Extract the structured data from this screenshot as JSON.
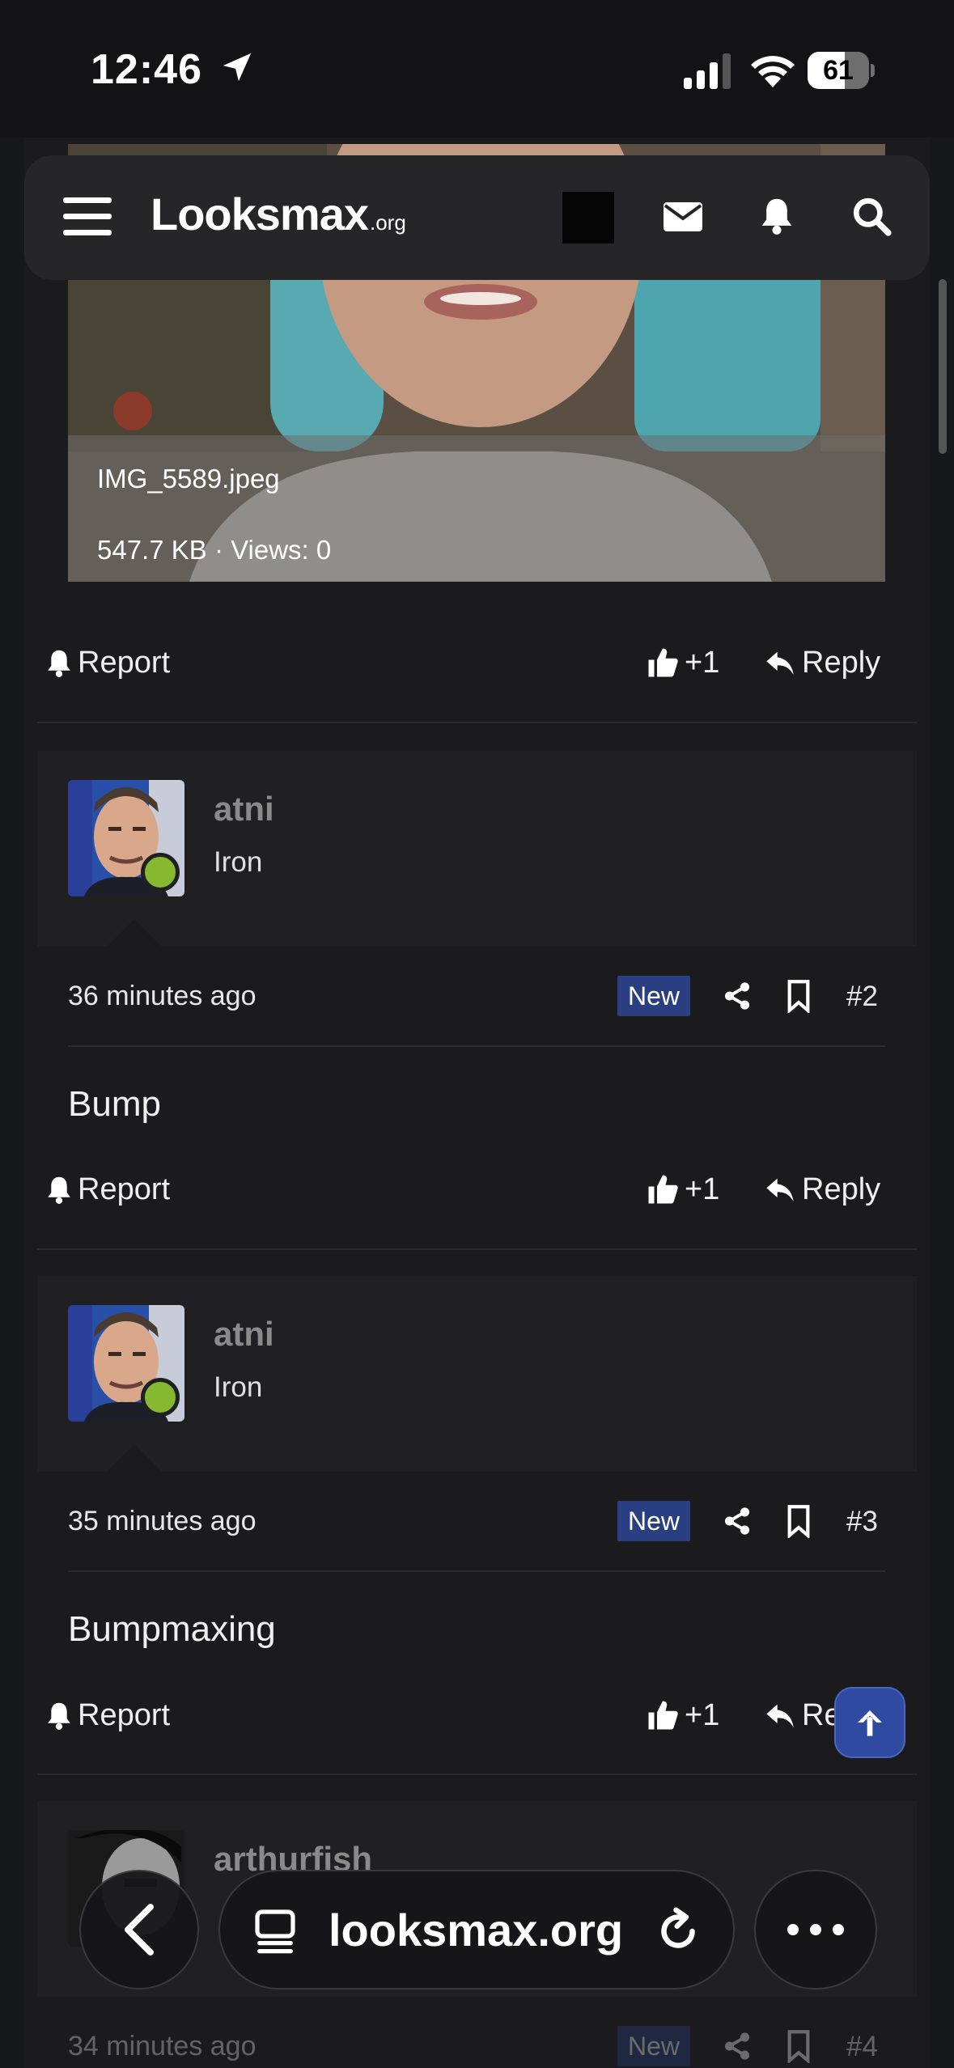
{
  "status_bar": {
    "time": "12:46",
    "battery": "61",
    "battery_level": 0.61
  },
  "site": {
    "logo": "Looksmax",
    "logo_tld": ".org"
  },
  "attachment": {
    "filename": "IMG_5589.jpeg",
    "stats": "547.7 KB · Views: 0"
  },
  "actions": {
    "report": "Report",
    "like": "+1",
    "reply": "Reply"
  },
  "posts": [
    {
      "username": "atni",
      "user_title": "Iron",
      "time": "36 minutes ago",
      "badge": "New",
      "number": "#2",
      "body": "Bump"
    },
    {
      "username": "atni",
      "user_title": "Iron",
      "time": "35 minutes ago",
      "badge": "New",
      "number": "#3",
      "body": "Bumpmaxing"
    },
    {
      "username": "arthurfish",
      "user_title": "",
      "time": "34 minutes ago",
      "badge": "New",
      "number": "#4",
      "body": ""
    }
  ],
  "browser": {
    "address": "looksmax.org"
  },
  "colors": {
    "accent": "#2f4aa0",
    "online": "#86b92f",
    "badge": "#2a3e82"
  }
}
